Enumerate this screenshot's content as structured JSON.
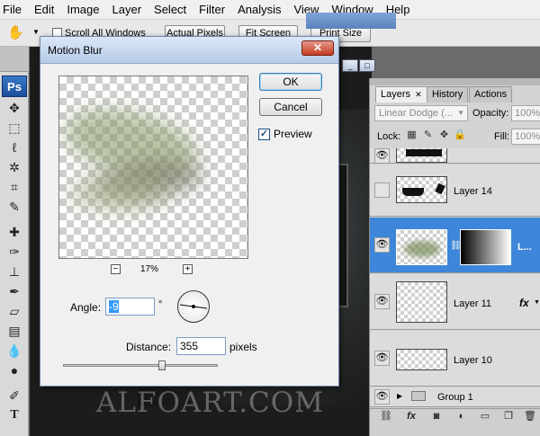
{
  "menu": [
    "File",
    "Edit",
    "Image",
    "Layer",
    "Select",
    "Filter",
    "Analysis",
    "View",
    "Window",
    "Help"
  ],
  "options_bar": {
    "scroll_all_windows": "Scroll All Windows",
    "actual_pixels": "Actual Pixels",
    "fit_screen": "Fit Screen",
    "print_size": "Print Size"
  },
  "tools": {
    "logo": "Ps",
    "icons": [
      "move-icon",
      "marquee-icon",
      "lasso-icon",
      "magic-wand-icon",
      "crop-icon",
      "eyedropper-icon",
      "healing-brush-icon",
      "brush-icon",
      "clone-stamp-icon",
      "history-brush-icon",
      "eraser-icon",
      "gradient-icon",
      "blur-icon",
      "dodge-icon",
      "pen-icon",
      "type-icon"
    ]
  },
  "dialog": {
    "title": "Motion Blur",
    "close": "✕",
    "ok": "OK",
    "cancel": "Cancel",
    "preview_label": "Preview",
    "preview_checked": true,
    "zoom_minus": "−",
    "zoom_plus": "+",
    "zoom_level": "17%",
    "angle_label": "Angle:",
    "angle_value": "-9",
    "degree_symbol": "°",
    "distance_label": "Distance:",
    "distance_value": "355",
    "distance_unit": "pixels"
  },
  "layers_panel": {
    "tabs": [
      {
        "label": "Layers",
        "active": true
      },
      {
        "label": "History",
        "active": false
      },
      {
        "label": "Actions",
        "active": false
      }
    ],
    "tab_close": "✕",
    "blend_mode": "Linear Dodge (...",
    "opacity_label": "Opacity:",
    "opacity_value": "100%",
    "lock_label": "Lock:",
    "fill_label": "Fill:",
    "fill_value": "100%",
    "layers": [
      {
        "name": "",
        "visible": true,
        "selected": false
      },
      {
        "name": "Layer 14",
        "visible": false,
        "selected": false
      },
      {
        "name": "L...",
        "visible": true,
        "selected": true
      },
      {
        "name": "Layer 11",
        "visible": true,
        "selected": false,
        "fx": "fx"
      },
      {
        "name": "Layer 10",
        "visible": true,
        "selected": false
      },
      {
        "name": "Group 1",
        "visible": true,
        "selected": false
      }
    ]
  },
  "watermark": "ALFOART.COM"
}
